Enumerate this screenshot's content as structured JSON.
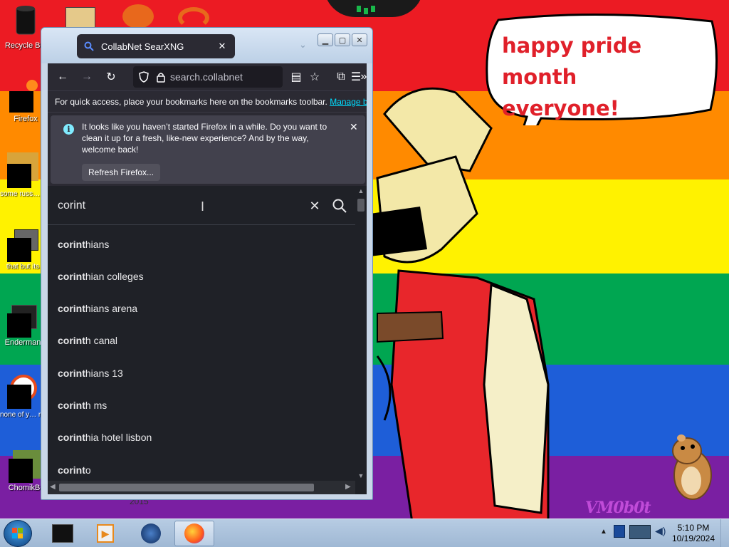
{
  "wallpaper": {
    "speech_bubble": [
      "happy pride month",
      "everyone!"
    ],
    "signature": "VM0b0t",
    "year_text": "2015",
    "colors": {
      "red": "#ec1b23",
      "orange": "#ff8a00",
      "yellow": "#fff200",
      "green": "#00a651",
      "blue": "#1e5ed8",
      "purple": "#7a1fa2"
    }
  },
  "desktop_icons": [
    {
      "label": "Recycle Bin",
      "icon": "recycle-bin-icon"
    },
    {
      "label": "Firefox",
      "icon": "firefox-icon"
    },
    {
      "label": "some russ… ran a rat",
      "icon": "generic-file-icon"
    },
    {
      "label": "that but its",
      "icon": "generic-file-icon"
    },
    {
      "label": "Enderman",
      "icon": "generic-file-icon"
    },
    {
      "label": "none of y… retards kn",
      "icon": "generic-file-icon"
    },
    {
      "label": "ChomikB",
      "icon": "generic-file-icon"
    }
  ],
  "browser": {
    "tab_title": "CollabNet SearXNG",
    "url": "search.collabnet",
    "bookmarks_bar_text": "For quick access, place your bookmarks here on the bookmarks toolbar.",
    "bookmarks_bar_link": "Manage bo",
    "notification": {
      "text": "It looks like you haven’t started Firefox in a while. Do you want to clean it up for a fresh, like-new experience? And by the way, welcome back!",
      "button": "Refresh Firefox..."
    },
    "search": {
      "query": "corint",
      "suggestions": [
        {
          "match": "corint",
          "rest": "hians"
        },
        {
          "match": "corint",
          "rest": "hian colleges"
        },
        {
          "match": "corint",
          "rest": "hians arena"
        },
        {
          "match": "corint",
          "rest": "h canal"
        },
        {
          "match": "corint",
          "rest": "hians 13"
        },
        {
          "match": "corint",
          "rest": "h ms"
        },
        {
          "match": "corint",
          "rest": "hia hotel lisbon"
        },
        {
          "match": "corint",
          "rest": "o"
        }
      ]
    },
    "theme": {
      "accent": "#00ddff",
      "toolbar": "#2b2a33",
      "content_bg": "#1f2127"
    }
  },
  "taskbar": {
    "time": "5:10 PM",
    "date": "10/19/2024"
  }
}
